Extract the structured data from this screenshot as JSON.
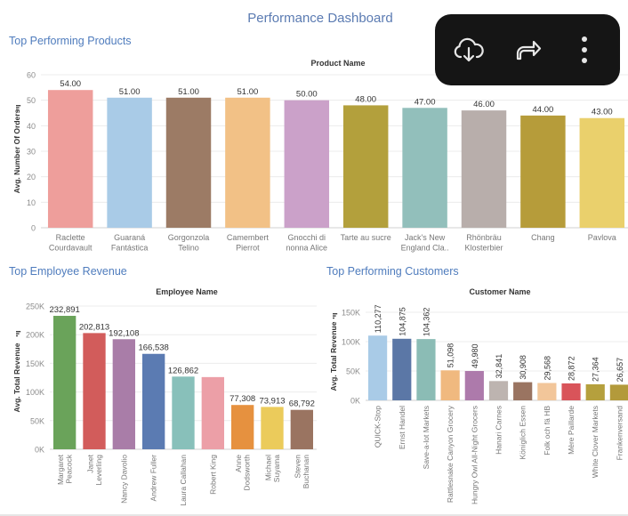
{
  "dashboard": {
    "title": "Performance Dashboard"
  },
  "toolbar": {
    "icons": [
      "cloud-download-icon",
      "share-icon",
      "more-vertical-icon"
    ]
  },
  "colors": {
    "section_title": "#4f7cbd",
    "toolbar_bg": "#151515",
    "axis_text": "#8c8c8c",
    "label_text": "#333333"
  },
  "sections": {
    "products": {
      "title": "Top Performing Products",
      "chart_data": {
        "type": "bar",
        "header": "Product Name",
        "ylabel": "Avg. Number Of Orders",
        "ylim": [
          0,
          60
        ],
        "yticks": [
          0,
          10,
          20,
          30,
          40,
          50,
          60
        ],
        "categories": [
          [
            "Raclette",
            "Courdavault"
          ],
          [
            "Guaraná",
            "Fantástica"
          ],
          [
            "Gorgonzola",
            "Telino"
          ],
          [
            "Camembert",
            "Pierrot"
          ],
          [
            "Gnocchi di",
            "nonna Alice"
          ],
          [
            "Tarte au sucre"
          ],
          [
            "Jack's New",
            "England Cla.."
          ],
          [
            "Rhönbräu",
            "Klosterbier"
          ],
          [
            "Chang"
          ],
          [
            "Pavlova"
          ]
        ],
        "values": [
          54,
          51,
          51,
          51,
          50,
          48,
          47,
          46,
          44,
          43
        ],
        "value_labels": [
          "54.00",
          "51.00",
          "51.00",
          "51.00",
          "50.00",
          "48.00",
          "47.00",
          "46.00",
          "44.00",
          "43.00"
        ],
        "colors": [
          "#ee9e9b",
          "#a9cbe7",
          "#9c7b65",
          "#f2c186",
          "#cba1c9",
          "#b3a03c",
          "#92bfbb",
          "#b8aeab",
          "#b69c3a",
          "#ead06c"
        ],
        "grid": true
      }
    },
    "employees": {
      "title": "Top Employee Revenue",
      "chart_data": {
        "type": "bar",
        "header": "Employee Name",
        "ylabel": "Avg. Total Revenue",
        "ylim": [
          0,
          250000
        ],
        "yticks": [
          0,
          50000,
          100000,
          150000,
          200000,
          250000
        ],
        "ytick_labels": [
          "0K",
          "50K",
          "100K",
          "150K",
          "200K",
          "250K"
        ],
        "categories": [
          [
            "Margaret",
            "Peacock"
          ],
          [
            "Janet",
            "Leverling"
          ],
          [
            "Nancy Davolio"
          ],
          [
            "Andrew Fuller"
          ],
          [
            "Laura Callahan"
          ],
          [
            "Robert King"
          ],
          [
            "Anne",
            "Dodsworth"
          ],
          [
            "Michael",
            "Suyama"
          ],
          [
            "Steven",
            "Buchanan"
          ]
        ],
        "values": [
          232891,
          202813,
          192108,
          166538,
          126862,
          126000,
          77308,
          73913,
          68792
        ],
        "value_labels": [
          "232,891",
          "202,813",
          "192,108",
          "166,538",
          "126,862",
          "",
          "77,308",
          "73,913",
          "68,792"
        ],
        "colors": [
          "#6aa35a",
          "#d25c5b",
          "#a97da8",
          "#5b7bb2",
          "#88c0ba",
          "#ec9fa7",
          "#e6913f",
          "#ebcb5b",
          "#9a7461"
        ],
        "grid": true
      }
    },
    "customers": {
      "title": "Top Performing Customers",
      "chart_data": {
        "type": "bar",
        "header": "Customer Name",
        "ylabel": "Avg. Total Revenue",
        "ylim": [
          0,
          150000
        ],
        "yticks": [
          0,
          50000,
          100000,
          150000
        ],
        "ytick_labels": [
          "0K",
          "50K",
          "100K",
          "150K"
        ],
        "categories": [
          "QUICK-Stop",
          "Ernst Handel",
          "Save-a-lot Markets",
          "Rattlesnake Canyon Grocery",
          "Hungry Owl All-Night Grocers",
          "Hanari Carnes",
          "Königlich Essen",
          "Folk och fä HB",
          "Mère Paillarde",
          "White Clover Markets",
          "Frankenversand"
        ],
        "values": [
          110277,
          104875,
          104362,
          51098,
          49980,
          32841,
          30908,
          29568,
          28872,
          27364,
          26657
        ],
        "value_labels": [
          "110,277",
          "104,875",
          "104,362",
          "51,098",
          "49,980",
          "32,841",
          "30,908",
          "29,568",
          "28,872",
          "27,364",
          "26,657"
        ],
        "colors": [
          "#a9cbe7",
          "#5b77a6",
          "#8bbcb5",
          "#f0b97f",
          "#ad7aab",
          "#bdb4b0",
          "#9a7461",
          "#f2c69a",
          "#d9545a",
          "#b5a03d",
          "#b39a3b"
        ],
        "grid": true
      }
    }
  }
}
